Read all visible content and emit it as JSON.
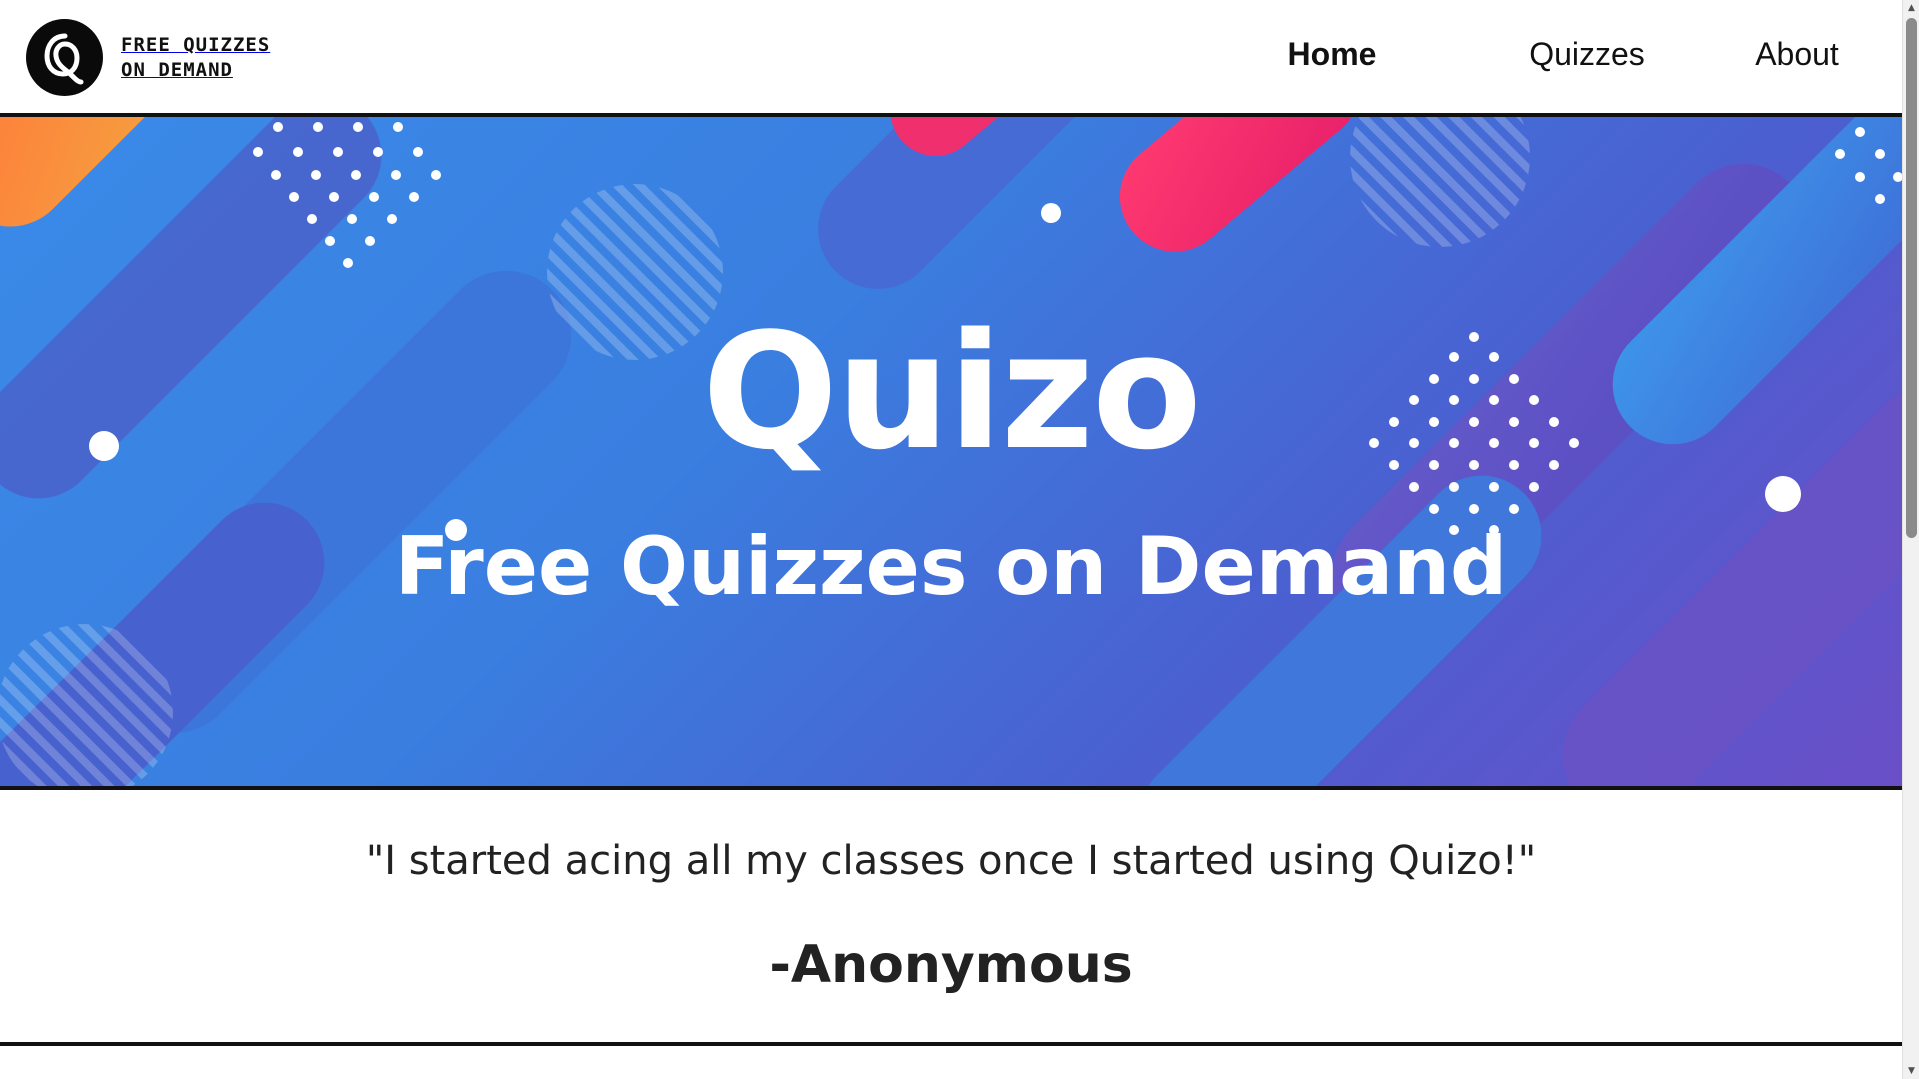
{
  "header": {
    "logo_text_line1": "FREE QUIZZES",
    "logo_text_line2": "ON DEMAND",
    "logo_icon": "q-logo-icon",
    "nav": {
      "home": "Home",
      "quizzes": "Quizzes",
      "about": "About",
      "active": "home"
    }
  },
  "hero": {
    "title": "Quizo",
    "subtitle": "Free Quizzes on Demand"
  },
  "testimonial": {
    "quote": "\"I started acing all my classes once I started using Quizo!\"",
    "author": "-Anonymous"
  },
  "colors": {
    "header_bg": "#ffffff",
    "border": "#111111",
    "hero_blue": "#3a8ae8",
    "hero_purple": "#6a4fc8",
    "accent_pink": "#f0306e",
    "accent_orange": "#f58a3a",
    "text_dark": "#222222"
  }
}
